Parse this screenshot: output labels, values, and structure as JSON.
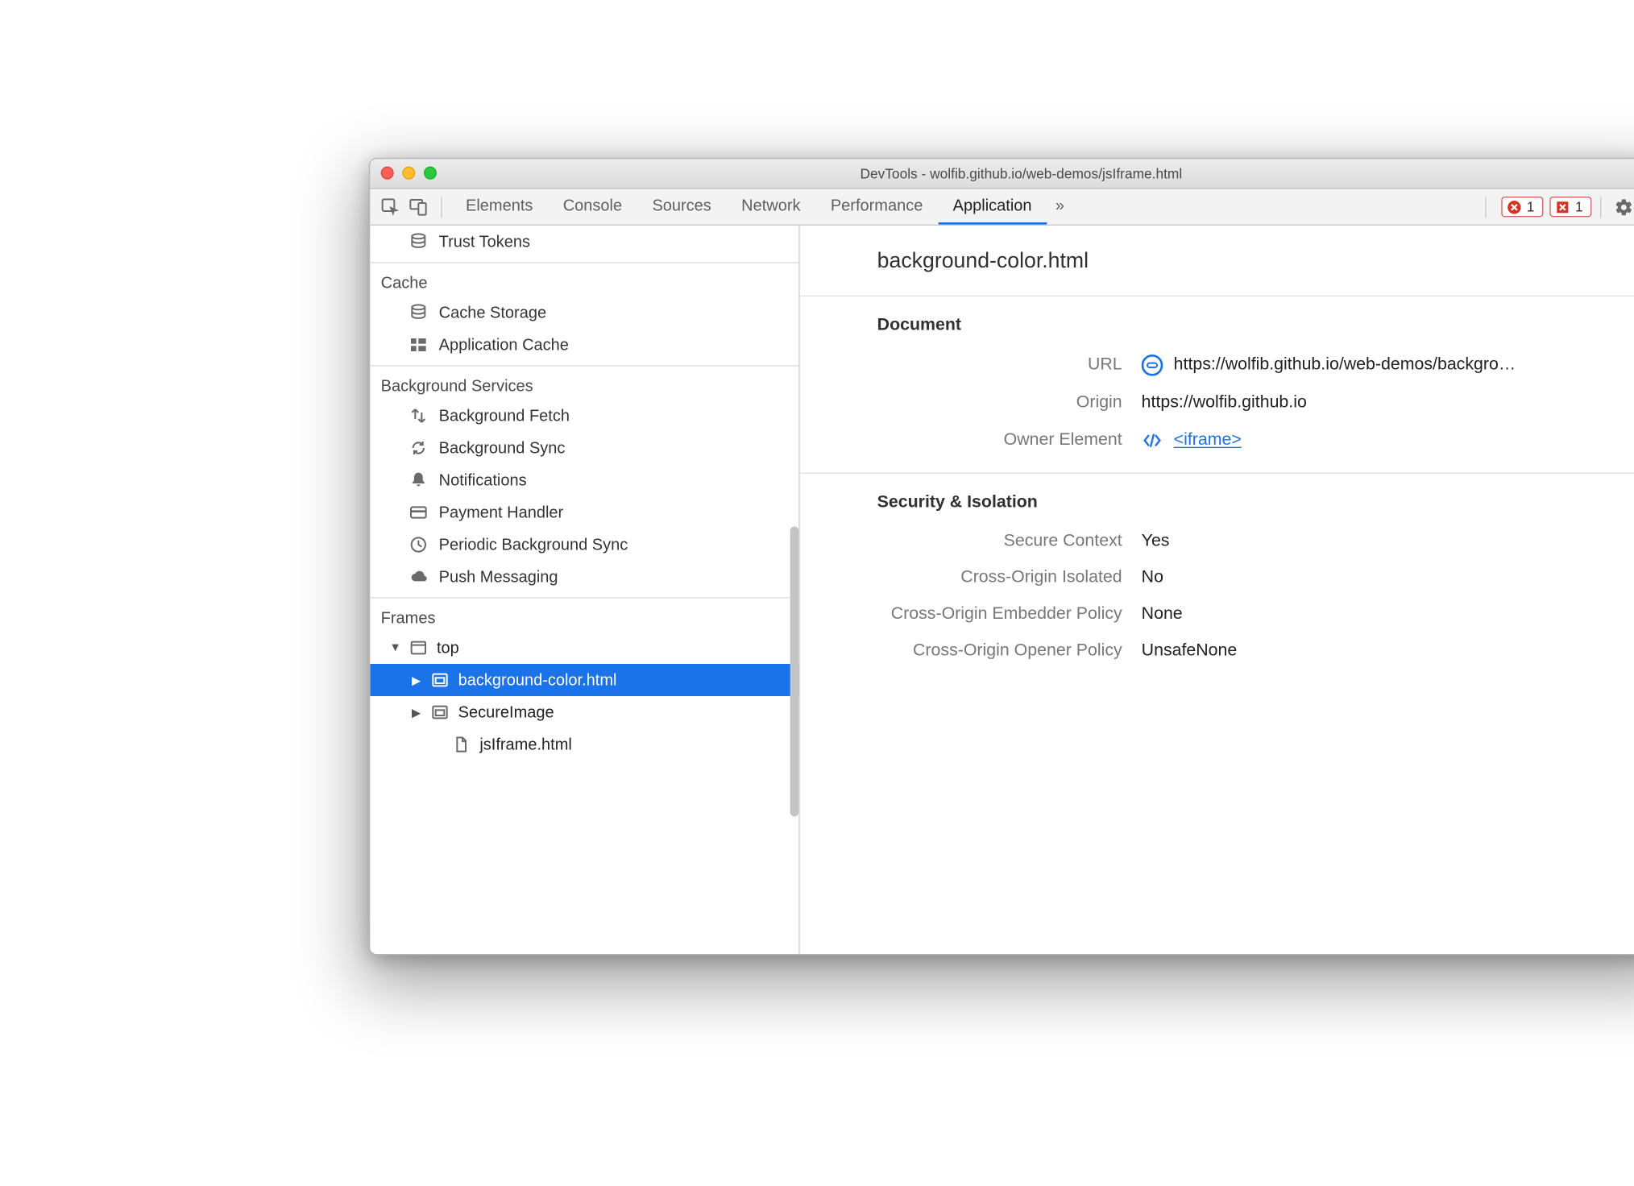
{
  "window": {
    "title": "DevTools - wolfib.github.io/web-demos/jsIframe.html"
  },
  "toolbar": {
    "tabs": [
      "Elements",
      "Console",
      "Sources",
      "Network",
      "Performance",
      "Application"
    ],
    "active_tab": 5,
    "overflow": "»",
    "error_count": "1",
    "issue_count": "1"
  },
  "sidebar": {
    "trust_tokens": "Trust Tokens",
    "group_cache": {
      "title": "Cache",
      "items": [
        "Cache Storage",
        "Application Cache"
      ]
    },
    "group_bg": {
      "title": "Background Services",
      "items": [
        "Background Fetch",
        "Background Sync",
        "Notifications",
        "Payment Handler",
        "Periodic Background Sync",
        "Push Messaging"
      ]
    },
    "group_frames": {
      "title": "Frames",
      "top": "top",
      "children": [
        {
          "label": "background-color.html",
          "selected": true,
          "expand": "▶"
        },
        {
          "label": "SecureImage",
          "selected": false,
          "expand": "▶"
        },
        {
          "label": "jsIframe.html",
          "selected": false,
          "expand": ""
        }
      ]
    }
  },
  "details": {
    "page_title": "background-color.html",
    "section1": {
      "heading": "Document",
      "url_label": "URL",
      "url_value": "https://wolfib.github.io/web-demos/backgro…",
      "origin_label": "Origin",
      "origin_value": "https://wolfib.github.io",
      "owner_label": "Owner Element",
      "owner_value": "<iframe>"
    },
    "section2": {
      "heading": "Security & Isolation",
      "rows": [
        {
          "k": "Secure Context",
          "v": "Yes"
        },
        {
          "k": "Cross-Origin Isolated",
          "v": "No"
        },
        {
          "k": "Cross-Origin Embedder Policy",
          "v": "None"
        },
        {
          "k": "Cross-Origin Opener Policy",
          "v": "UnsafeNone"
        }
      ]
    }
  }
}
